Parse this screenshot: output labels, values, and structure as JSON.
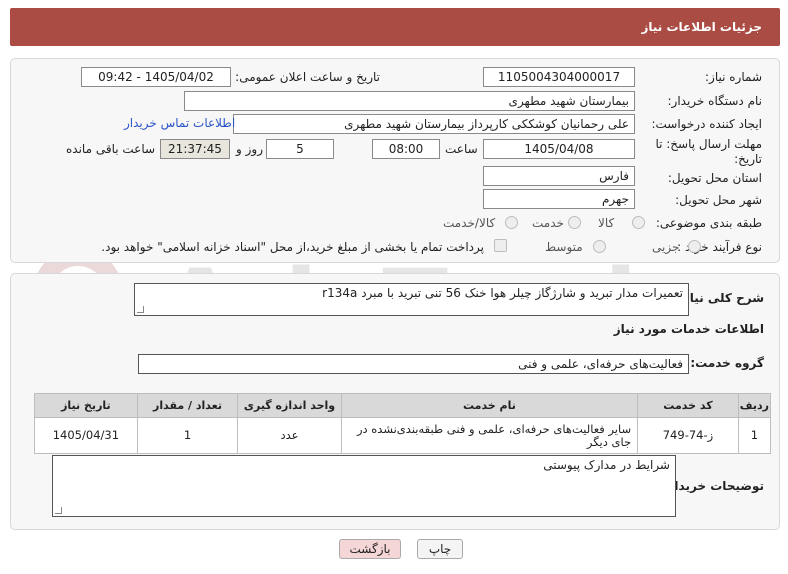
{
  "header": {
    "title": "جزئیات اطلاعات نیاز"
  },
  "form": {
    "need_number_label": "شماره نیاز:",
    "need_number": "1105004304000017",
    "announce_label": "تاریخ و ساعت اعلان عمومی:",
    "announce_value": "1405/04/02 - 09:42",
    "buyer_org_label": "نام دستگاه خریدار:",
    "buyer_org": "بیمارستان شهید مطهری",
    "creator_label": "ایجاد کننده درخواست:",
    "creator": "علی رحمانیان کوشککی کارپرداز بیمارستان شهید مطهری",
    "contact_link": "اطلاعات تماس خریدار",
    "deadline_label_1": "مهلت ارسال پاسخ: تا",
    "deadline_label_2": "تاریخ:",
    "deadline_date": "1405/04/08",
    "time_label": "ساعت",
    "deadline_time": "08:00",
    "days_value": "5",
    "days_label": "روز و",
    "remaining_time": "21:37:45",
    "remaining_label": "ساعت باقی مانده",
    "province_label": "استان محل تحویل:",
    "province": "فارس",
    "city_label": "شهر محل تحویل:",
    "city": "جهرم",
    "category_label": "طبقه بندی موضوعی:",
    "category_options": [
      "کالا",
      "خدمت",
      "کالا/خدمت"
    ],
    "purchase_type_label": "نوع فرآیند خرید :",
    "purchase_options": [
      "جزیی",
      "متوسط"
    ],
    "payment_note": "پرداخت تمام یا بخشی از مبلغ خرید،از محل \"اسناد خزانه اسلامی\" خواهد بود."
  },
  "summary": {
    "label": "شرح کلی نیاز:",
    "value": "تعمیرات مدار تبرید و شارژگاز چیلر هوا خنک 56 تنی تبرید با مبرد r134a"
  },
  "services": {
    "section_title": "اطلاعات خدمات مورد نیاز",
    "group_label": "گروه خدمت:",
    "group_value": "فعالیت‌های حرفه‌ای، علمی و فنی",
    "columns": [
      "ردیف",
      "کد خدمت",
      "نام خدمت",
      "واحد اندازه گیری",
      "تعداد / مقدار",
      "تاریخ نیاز"
    ],
    "rows": [
      {
        "row": "1",
        "code": "ز-74-749",
        "name": "سایر فعالیت‌های حرفه‌ای، علمی و فنی طبقه‌بندی‌نشده در جای دیگر",
        "unit": "عدد",
        "qty": "1",
        "date": "1405/04/31"
      }
    ]
  },
  "buyer_notes": {
    "label": "توضیحات خریدار:",
    "value": "شرایط در مدارک پیوستی"
  },
  "buttons": {
    "print": "چاپ",
    "back": "بازگشت"
  },
  "watermark": {
    "text": "AriaTender.net"
  },
  "colors": {
    "header": "#aa4b44",
    "link": "#2a55c8",
    "back_button": "#f5d6d6"
  }
}
